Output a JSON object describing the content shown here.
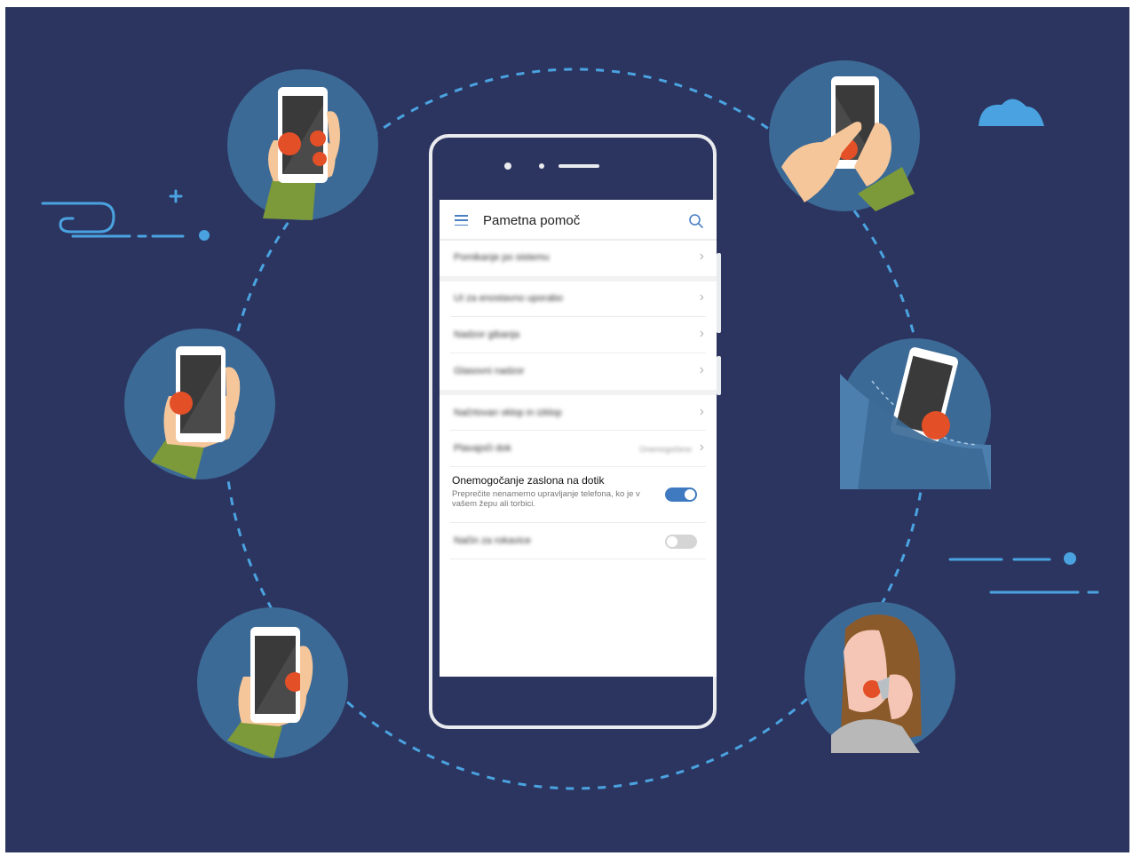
{
  "screen": {
    "title": "Pametna pomoč",
    "rows": [
      {
        "label": "Pomikanje po sistemu",
        "blurred": true
      },
      {
        "label": "UI za enostavno uporabo",
        "blurred": true
      },
      {
        "label": "Nadzor gibanja",
        "blurred": true
      },
      {
        "label": "Glasovni nadzor",
        "blurred": true
      },
      {
        "label": "Načrtovan vklop in izklop",
        "blurred": true
      },
      {
        "label": "Plavajoči dok",
        "value": "Onemogočeno",
        "blurred": true
      }
    ],
    "touch_disable": {
      "title": "Onemogočanje zaslona na dotik",
      "subtitle": "Preprečite nenamerno upravljanje telefona, ko je v vašem žepu ali torbici.",
      "enabled": true
    },
    "glove_mode": {
      "label": "Način za rokavice",
      "enabled": false,
      "blurred": true
    }
  },
  "icons": {
    "menu": "hamburger-menu-icon",
    "search": "search-icon",
    "chevron": "chevron-right-icon"
  },
  "colors": {
    "background": "#2c3560",
    "circle": "#3c6a96",
    "accent": "#4a7fc2",
    "toggle_on": "#3f7ac0",
    "toggle_off": "#d5d5d5",
    "highlight": "#e34f27",
    "dashes": "#4aa3e0"
  }
}
